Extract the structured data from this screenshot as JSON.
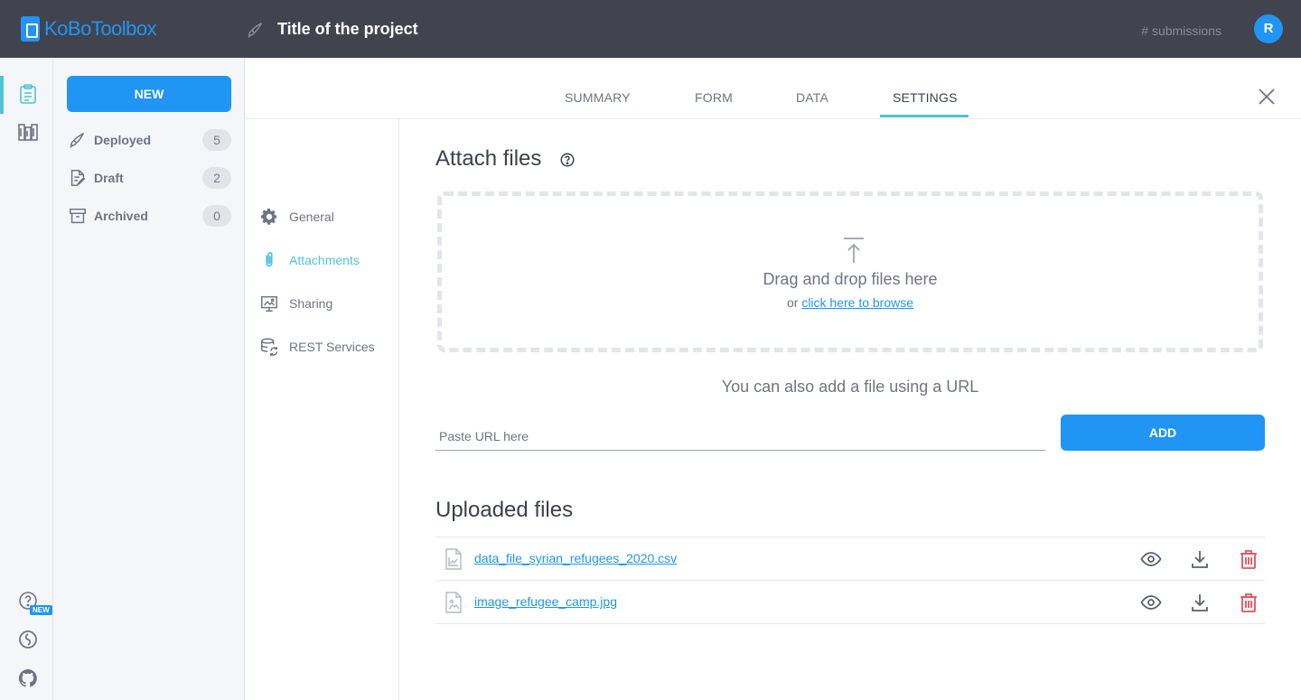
{
  "header": {
    "logo_text": "KoBoToolbox",
    "project_title": "Title of the project",
    "submissions": "# submissions",
    "avatar_initial": "R"
  },
  "rail": {
    "icons": [
      "projects-icon",
      "library-icon",
      "help-icon",
      "support-icon",
      "github-icon"
    ],
    "help_badge": "NEW"
  },
  "projects_panel": {
    "new_label": "NEW",
    "items": [
      {
        "label": "Deployed",
        "count": "5",
        "icon": "rocket-icon"
      },
      {
        "label": "Draft",
        "count": "2",
        "icon": "draft-icon"
      },
      {
        "label": "Archived",
        "count": "0",
        "icon": "archive-icon"
      }
    ]
  },
  "tabs": [
    {
      "label": "SUMMARY",
      "active": false
    },
    {
      "label": "FORM",
      "active": false
    },
    {
      "label": "DATA",
      "active": false
    },
    {
      "label": "SETTINGS",
      "active": true
    }
  ],
  "settings_nav": [
    {
      "label": "General",
      "icon": "gear-icon",
      "active": false
    },
    {
      "label": "Attachments",
      "icon": "paperclip-icon",
      "active": true
    },
    {
      "label": "Sharing",
      "icon": "sharing-icon",
      "active": false
    },
    {
      "label": "REST Services",
      "icon": "rest-services-icon",
      "active": false
    }
  ],
  "attach": {
    "title": "Attach files",
    "drop_title": "Drag and drop files here",
    "drop_or": "or ",
    "browse_link": "click here to browse",
    "url_hint": "You can also add a file using a URL",
    "url_placeholder": "Paste URL here",
    "add_label": "ADD"
  },
  "uploaded": {
    "title": "Uploaded files",
    "files": [
      {
        "name": "data_file_syrian_refugees_2020.csv",
        "type": "csv"
      },
      {
        "name": "image_refugee_camp.jpg",
        "type": "image"
      }
    ]
  },
  "colors": {
    "accent": "#2095f3",
    "teal": "#4ec3d8",
    "topbar": "#41444f",
    "danger": "#e5505b"
  }
}
